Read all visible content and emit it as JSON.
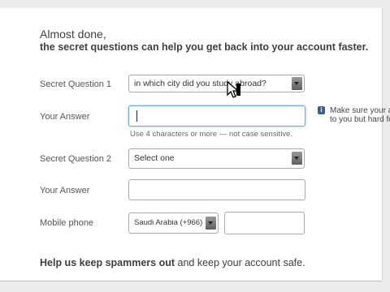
{
  "header": {
    "title": "Almost done,",
    "subtitle": "the secret questions can help you get back into your account faster."
  },
  "form": {
    "q1_label": "Secret Question 1",
    "q1_value": "in which city did you study abroad?",
    "answer1_label": "Your Answer",
    "answer1_hint": "Use 4 characters or more — not case sensitive.",
    "q2_label": "Secret Question 2",
    "q2_value": "Select one",
    "answer2_label": "Your Answer",
    "mobile_label": "Mobile phone",
    "country_value": "Saudi Arabia (+966)"
  },
  "tip": {
    "line1": "Make sure your am",
    "line2": "to you but hard for"
  },
  "footer": {
    "strong": "Help us keep spammers out",
    "rest": " and keep your account safe."
  },
  "icons": {
    "info": "info-icon",
    "dropdown": "chevron-down-icon",
    "cursor": "mouse-pointer-icon"
  }
}
